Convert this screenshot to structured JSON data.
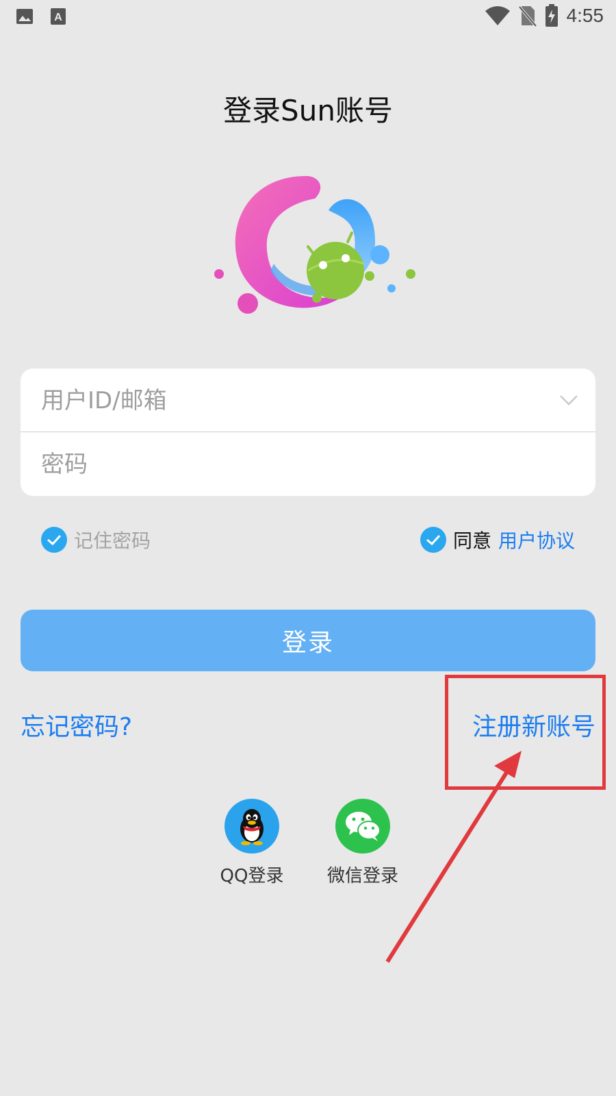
{
  "status_bar": {
    "left_icons": [
      "image-icon",
      "text-a-icon"
    ],
    "right_icons": [
      "wifi-icon",
      "no-sim-icon",
      "battery-charging-icon"
    ],
    "time": "4:55"
  },
  "page": {
    "title": "登录Sun账号",
    "logo": "app-logo-android"
  },
  "form": {
    "user_placeholder": "用户ID/邮箱",
    "user_value": "",
    "password_placeholder": "密码",
    "password_value": ""
  },
  "options": {
    "remember_label": "记住密码",
    "remember_checked": true,
    "agree_label": "同意",
    "agreement_link": "用户协议",
    "agree_checked": true
  },
  "actions": {
    "login_label": "登录",
    "forgot_label": "忘记密码?",
    "register_label": "注册新账号"
  },
  "social": {
    "qq_label": "QQ登录",
    "wechat_label": "微信登录"
  },
  "colors": {
    "accent": "#1c7df0",
    "login_button": "#63b0f5",
    "checkbox": "#2aa7ef",
    "annotation": "#e03a3e",
    "qq": "#2ba3ec",
    "wechat": "#2dc24e"
  }
}
